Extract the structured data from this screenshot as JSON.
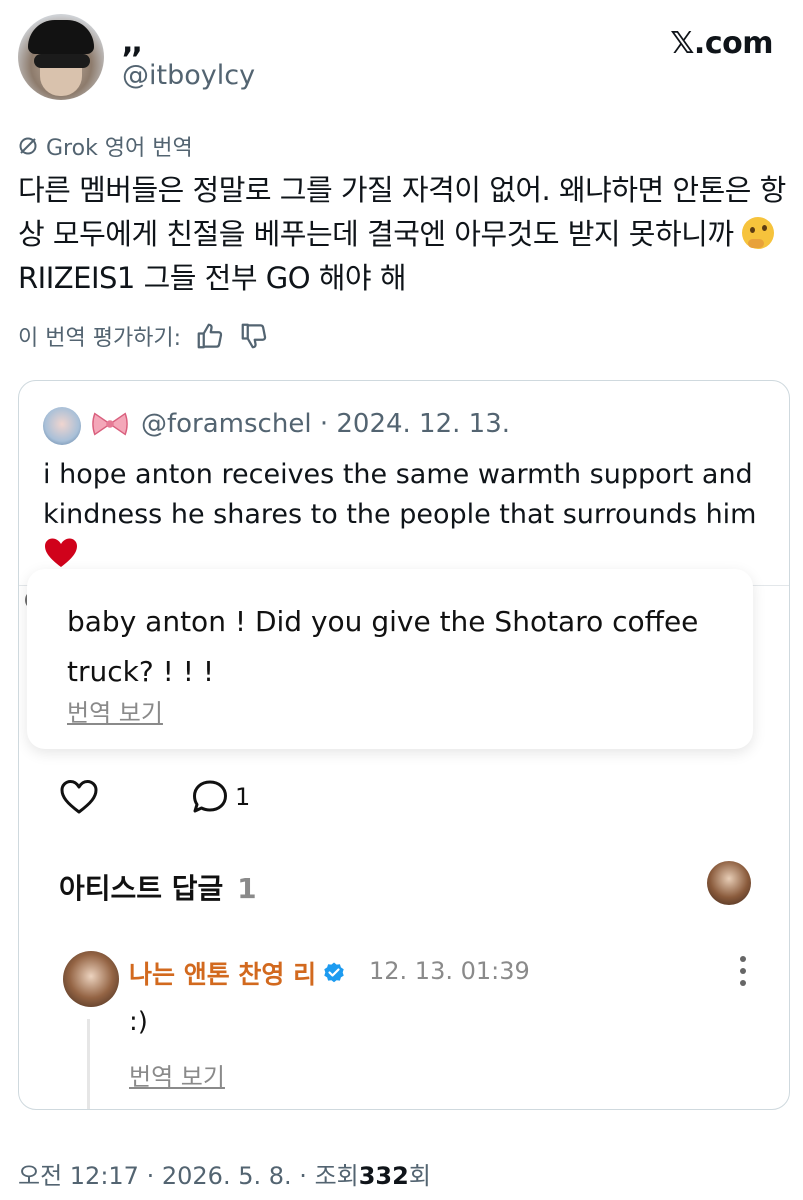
{
  "header": {
    "display_name": ",,",
    "handle": "@itboylcy",
    "brand": "𝕏.com"
  },
  "translation": {
    "label": "Grok 영어 번역",
    "text_main": "다른 멤버들은 정말로 그를 가질 자격이 없어. 왜냐하면 안톤은 항상 모두에게 친절을 베푸는데 결국엔 아무것도 받지 못하니까",
    "text_tail": "RIIZEIS1 그들 전부 GO 해야 해",
    "rate_label": "이 번역 평가하기:"
  },
  "quote": {
    "handle": "@foramschel",
    "separator": "·",
    "date": "2024. 12. 13.",
    "text": "i hope anton receives the same warmth support and kindness he shares to the people that surrounds him",
    "inner": {
      "text": "baby anton ! Did you give the Shotaro coffee truck? ! ! !",
      "translate_link": "번역 보기"
    },
    "actions": {
      "reply_count": "1"
    },
    "artist_section": {
      "title": "아티스트 답글",
      "count": "1"
    },
    "artist_reply": {
      "name": "나는 앤톤 찬영 리",
      "date": "12. 13. 01:39",
      "text": ":)",
      "translate_link": "번역 보기"
    }
  },
  "footer": {
    "time": "오전 12:17",
    "date": "2026. 5. 8.",
    "views_label": "조회",
    "views_count": "332",
    "views_suffix": "회",
    "sep": "·"
  },
  "colors": {
    "text": "#0f1419",
    "muted": "#536471",
    "artist_name": "#d2691e",
    "verified": "#1d9bf0",
    "heart": "#d0021b"
  }
}
